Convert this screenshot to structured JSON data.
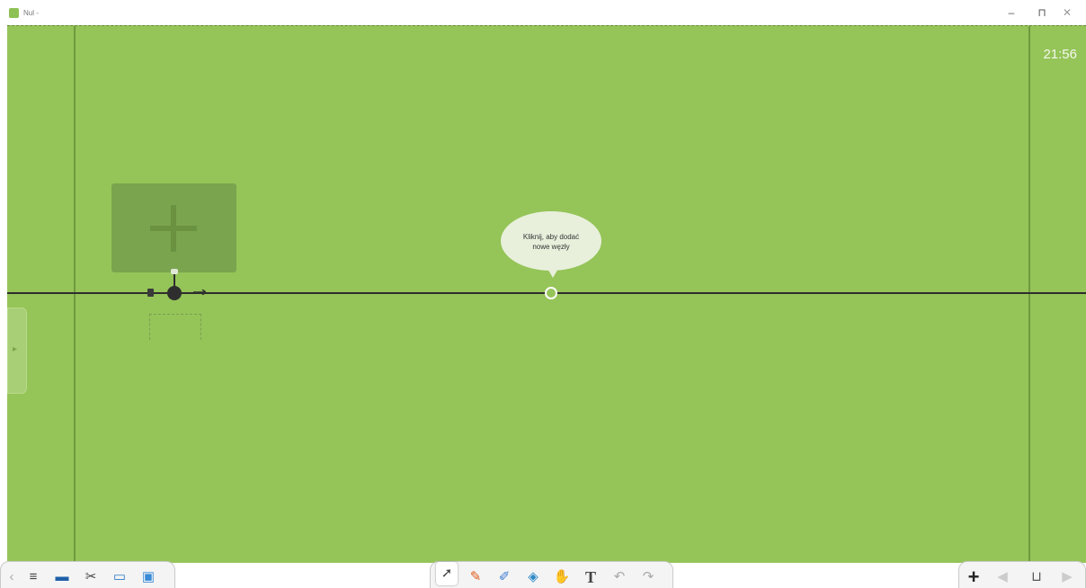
{
  "window": {
    "title": "Nul -",
    "controls": {
      "minimize": "–",
      "maximize": "⊓",
      "close": "✕"
    }
  },
  "canvas": {
    "background_color": "#95c458",
    "clock": "21:56",
    "bubble": {
      "line1": "Kliknij, aby dodać",
      "line2": "nowe węzły"
    },
    "add_card_icon": "plus-icon",
    "side_tab_icon": "chevron-right-icon"
  },
  "toolbar_left": {
    "items": [
      {
        "name": "chevron-left-icon",
        "glyph": "‹"
      },
      {
        "name": "menu-icon",
        "glyph": "≡"
      },
      {
        "name": "display-icon",
        "glyph": "▬"
      },
      {
        "name": "tools-icon",
        "glyph": "✂"
      },
      {
        "name": "folder-icon",
        "glyph": "▭"
      },
      {
        "name": "image-icon",
        "glyph": "▣"
      }
    ]
  },
  "toolbar_center": {
    "items": [
      {
        "name": "select-arrow-icon",
        "glyph": "➚"
      },
      {
        "name": "pen-icon",
        "glyph": "✎"
      },
      {
        "name": "highlighter-icon",
        "glyph": "✐"
      },
      {
        "name": "fill-icon",
        "glyph": "◈"
      },
      {
        "name": "eraser-icon",
        "glyph": "✋"
      },
      {
        "name": "text-icon",
        "glyph": "T"
      },
      {
        "name": "undo-icon",
        "glyph": "↶"
      },
      {
        "name": "redo-icon",
        "glyph": "↷"
      }
    ]
  },
  "toolbar_right": {
    "items": [
      {
        "name": "add-page-icon",
        "glyph": "+"
      },
      {
        "name": "prev-page-icon",
        "glyph": "◀"
      },
      {
        "name": "page-sorter-icon",
        "glyph": "⊔"
      },
      {
        "name": "next-page-icon",
        "glyph": "▶"
      }
    ]
  }
}
